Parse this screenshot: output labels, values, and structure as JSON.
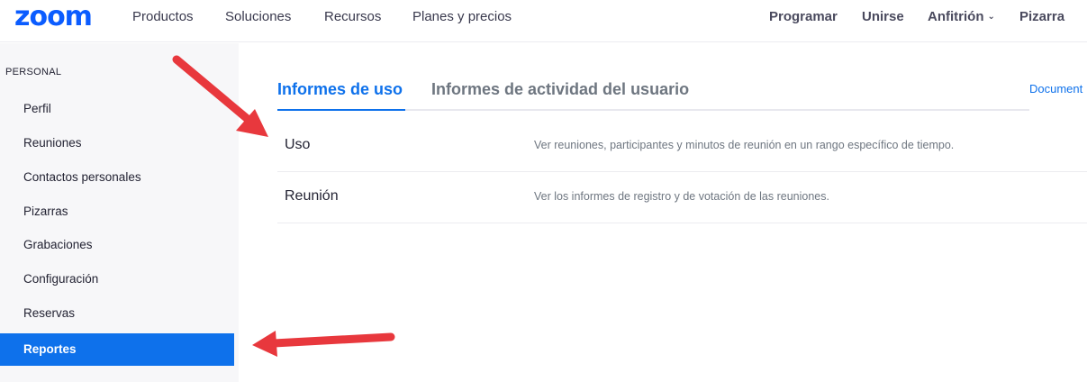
{
  "header": {
    "logo": "zoom",
    "nav_left": [
      "Productos",
      "Soluciones",
      "Recursos",
      "Planes y precios"
    ],
    "nav_right": [
      "Programar",
      "Unirse",
      "Anfitrión",
      "Pizarra"
    ]
  },
  "sidebar": {
    "section": "PERSONAL",
    "items": [
      "Perfil",
      "Reuniones",
      "Contactos personales",
      "Pizarras",
      "Grabaciones",
      "Configuración",
      "Reservas",
      "Reportes"
    ],
    "active": "Reportes"
  },
  "main": {
    "tabs": [
      "Informes de uso",
      "Informes de actividad del usuario"
    ],
    "doc_link": "Document",
    "rows": [
      {
        "title": "Uso",
        "description": "Ver reuniones, participantes y minutos de reunión en un rango específico de tiempo."
      },
      {
        "title": "Reunión",
        "description": "Ver los informes de registro y de votación de las reuniones."
      }
    ]
  },
  "colors": {
    "accent": "#0e71eb",
    "logo": "#0b5cff",
    "annotation_arrow": "#e8383d"
  }
}
